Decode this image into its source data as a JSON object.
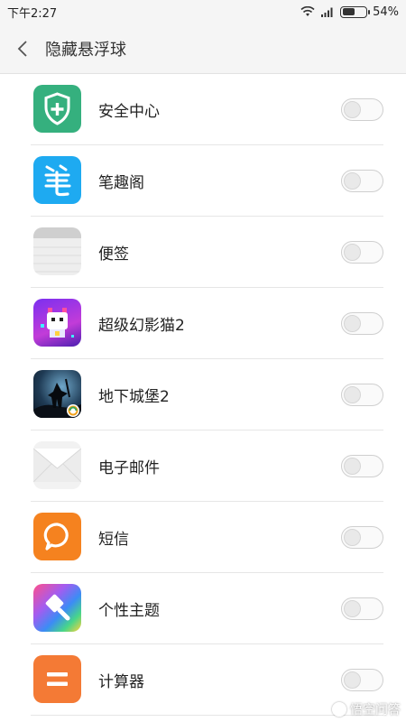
{
  "status_bar": {
    "time": "下午2:27",
    "battery_text": "54%",
    "battery_level": 0.54,
    "icons": [
      "wifi-icon",
      "signal-icon",
      "battery-icon"
    ]
  },
  "header": {
    "title": "隐藏悬浮球",
    "back_icon": "chevron-left-icon"
  },
  "apps": [
    {
      "name": "安全中心",
      "icon": "security-center-icon",
      "enabled": false
    },
    {
      "name": "笔趣阁",
      "icon": "biquge-icon",
      "enabled": false
    },
    {
      "name": "便签",
      "icon": "notes-icon",
      "enabled": false
    },
    {
      "name": "超级幻影猫2",
      "icon": "phantom-cat-icon",
      "enabled": false
    },
    {
      "name": "地下城堡2",
      "icon": "underground-castle-icon",
      "enabled": false
    },
    {
      "name": "电子邮件",
      "icon": "email-icon",
      "enabled": false
    },
    {
      "name": "短信",
      "icon": "sms-icon",
      "enabled": false
    },
    {
      "name": "个性主题",
      "icon": "themes-icon",
      "enabled": false
    },
    {
      "name": "计算器",
      "icon": "calculator-icon",
      "enabled": false
    }
  ],
  "watermark": {
    "text": "悟空问答"
  },
  "colors": {
    "security_green": "#35b07e",
    "biquge_blue": "#1eaaf1",
    "sms_orange": "#f5821f",
    "calculator_orange": "#f47a35",
    "toggle_off": "#e9e9e9"
  }
}
